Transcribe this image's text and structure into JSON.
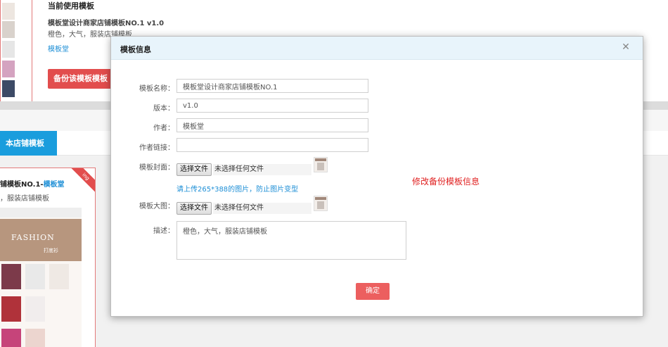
{
  "background": {
    "current_template": {
      "heading": "当前使用模板",
      "name": "模板堂设计商家店铺模板NO.1 v1.0",
      "description": "橙色，大气，服装店铺模板",
      "author": "模板堂",
      "backup_button": "备份该模板模板"
    },
    "tabs": [
      {
        "label": "本店铺模板",
        "active": true
      }
    ],
    "card": {
      "title_prefix": "铺模板NO.1-",
      "title_author": "模板堂",
      "description": "，服装店铺模板",
      "ribbon": "ing",
      "banner_text": "FASHION",
      "banner_sub": "打底衫"
    }
  },
  "modal": {
    "title": "模板信息",
    "close_icon": "close-icon",
    "fields": {
      "name_label": "模板名称：",
      "name_value": "模板堂设计商家店铺模板NO.1",
      "version_label": "版本：",
      "version_value": "v1.0",
      "author_label": "作者：",
      "author_value": "模板堂",
      "author_link_label": "作者链接：",
      "author_link_value": "",
      "cover_label": "模板封面：",
      "big_image_label": "模板大图：",
      "file_button": "选择文件",
      "no_file": "未选择任何文件",
      "upload_hint": "请上传265*388的图片，防止图片变型",
      "desc_label": "描述：",
      "desc_value": "橙色，大气，服装店铺模板"
    },
    "annotation": "修改备份模板信息",
    "confirm_button": "确定"
  },
  "colors": {
    "accent_blue": "#1a9ddd",
    "accent_red": "#e24d4d",
    "link_blue": "#1e8fd6",
    "annotation_red": "#e02020"
  }
}
